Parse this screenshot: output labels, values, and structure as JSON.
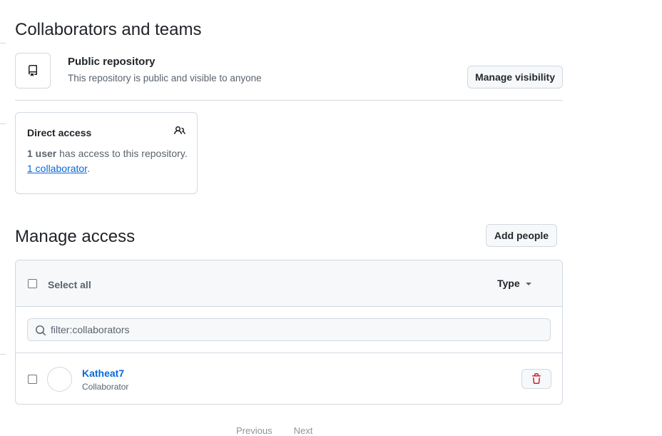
{
  "page_title": "Collaborators and teams",
  "visibility": {
    "title": "Public repository",
    "description": "This repository is public and visible to anyone",
    "button_label": "Manage visibility"
  },
  "direct_access": {
    "title": "Direct access",
    "users_count": "1 user",
    "users_suffix": " has access to this repository.",
    "collaborator_link": "1 collaborator",
    "collaborator_suffix": "."
  },
  "manage_access": {
    "title": "Manage access",
    "add_button": "Add people",
    "select_all_label": "Select all",
    "type_filter_label": "Type",
    "filter_value": "filter:collaborators",
    "members": [
      {
        "name": "Katheat7",
        "role": "Collaborator"
      }
    ]
  },
  "pagination": {
    "previous": "Previous",
    "next": "Next"
  },
  "colors": {
    "link": "#0969da",
    "danger": "#cf222e",
    "border": "#d1d9e0",
    "muted": "#59636e"
  },
  "icons": {
    "repo": "repo-icon",
    "people": "people-icon",
    "search": "search-icon",
    "trash": "trash-icon",
    "caret": "caret-down-icon"
  }
}
